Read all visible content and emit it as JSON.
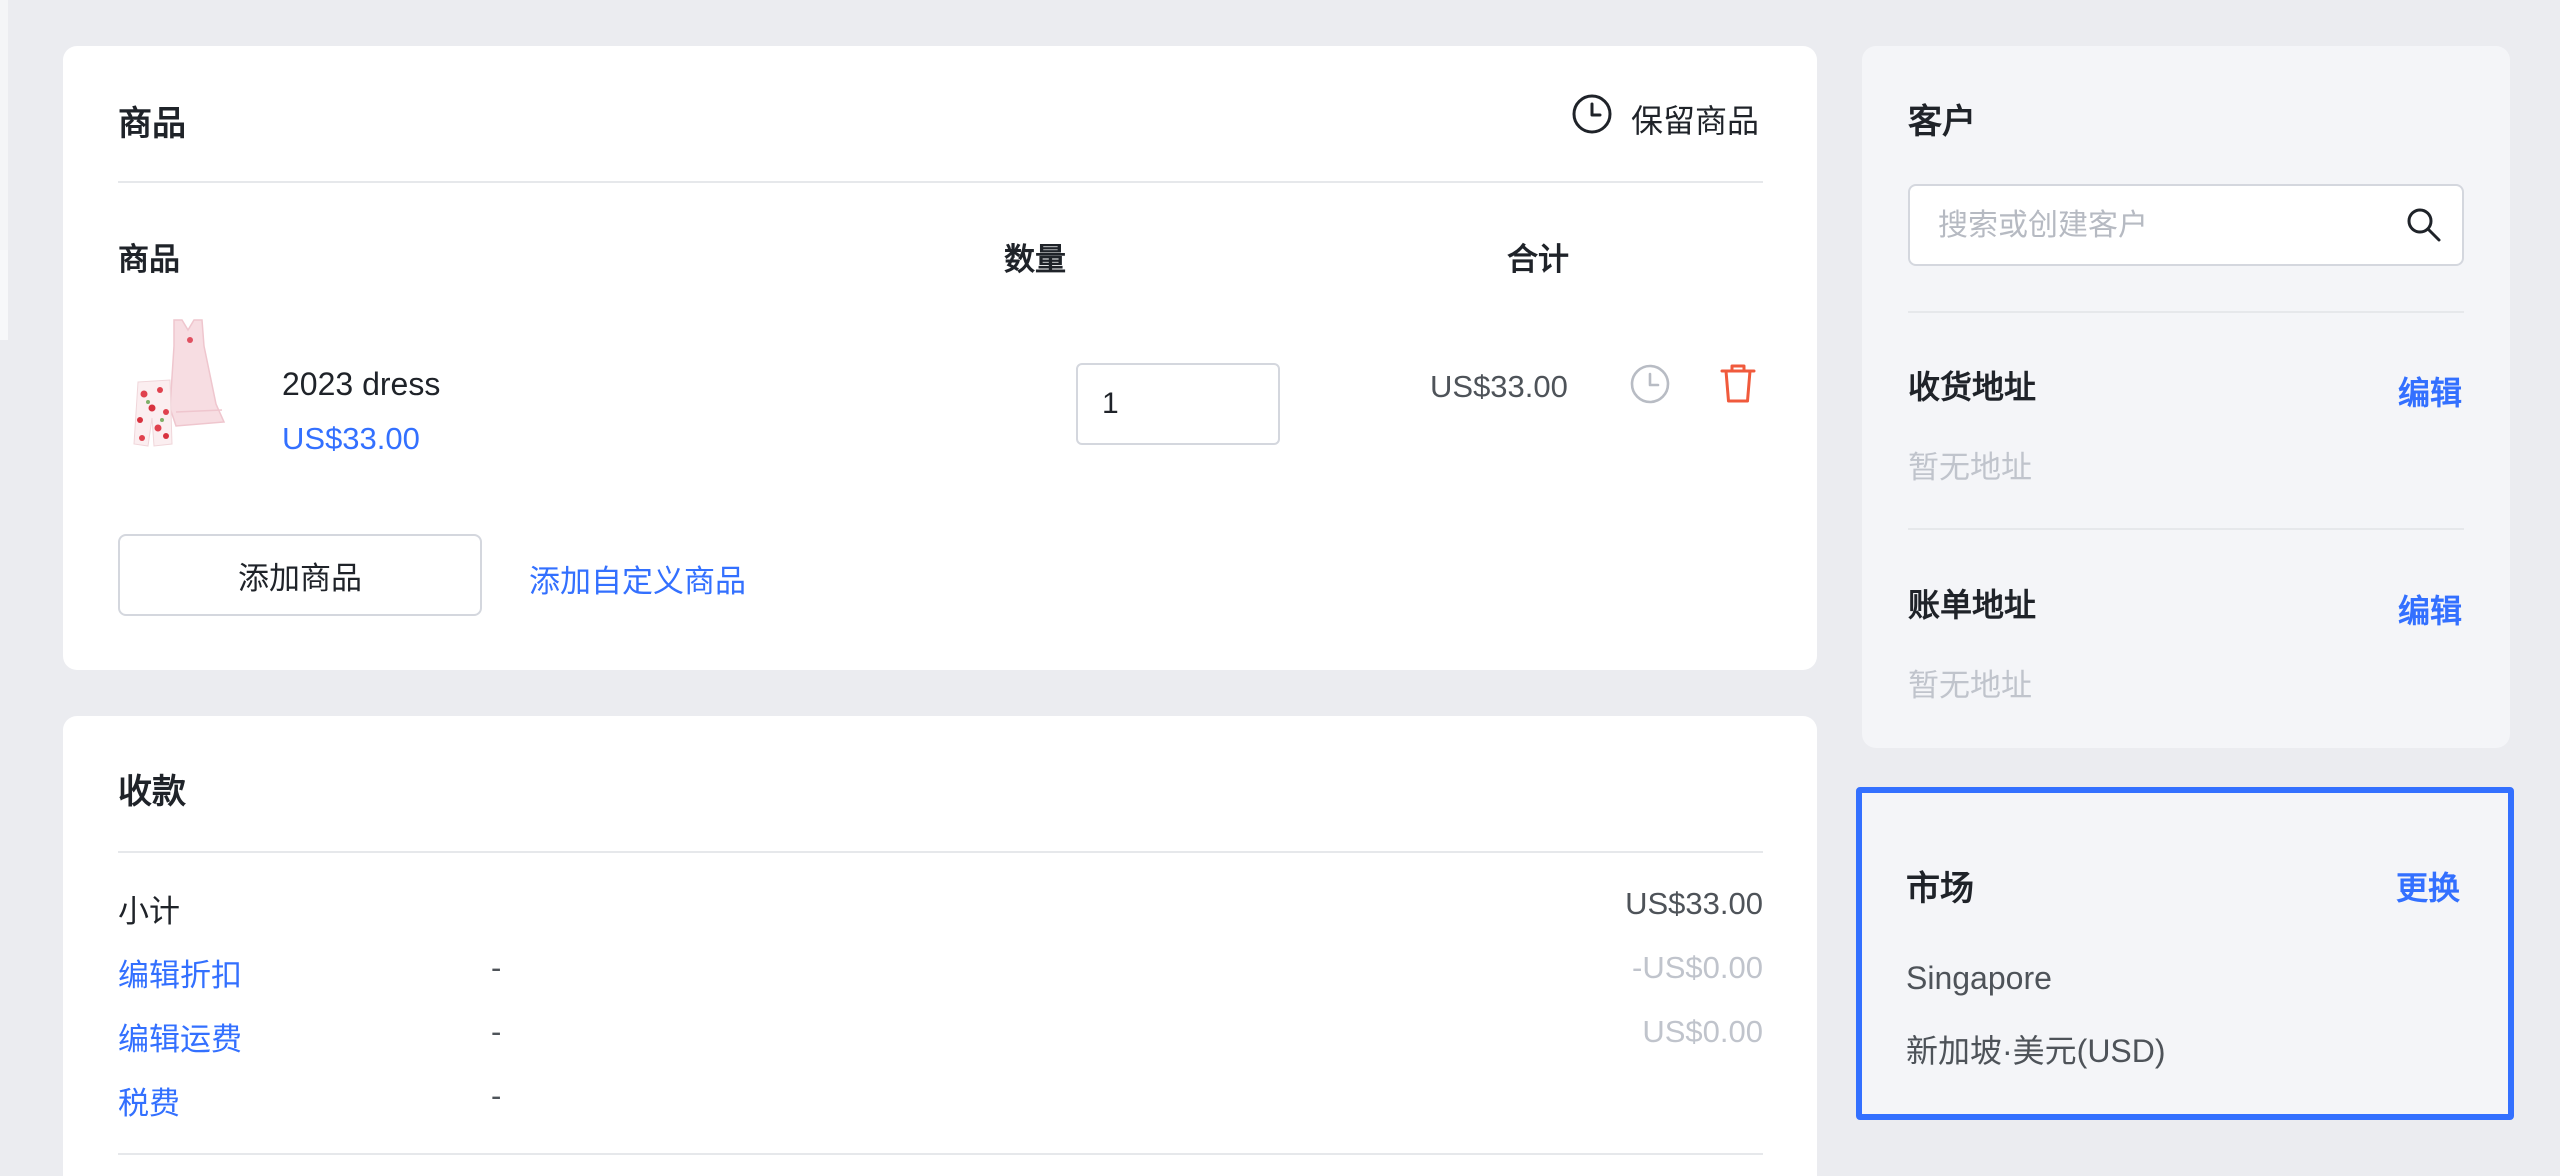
{
  "products_card": {
    "title": "商品",
    "hold_label": "保留商品",
    "columns": {
      "product": "商品",
      "quantity": "数量",
      "total": "合计"
    },
    "items": [
      {
        "name": "2023 dress",
        "price": "US$33.00",
        "quantity": "1",
        "total": "US$33.00"
      }
    ],
    "add_product_label": "添加商品",
    "add_custom_label": "添加自定义商品"
  },
  "payment_card": {
    "title": "收款",
    "rows": [
      {
        "label": "小计",
        "detail": "",
        "value": "US$33.00"
      },
      {
        "label": "编辑折扣",
        "detail": "-",
        "value": "-US$0.00"
      },
      {
        "label": "编辑运费",
        "detail": "-",
        "value": "US$0.00"
      },
      {
        "label": "税费",
        "detail": "-",
        "value": ""
      }
    ]
  },
  "customer_card": {
    "title": "客户",
    "search_placeholder": "搜索或创建客户",
    "shipping": {
      "title": "收货地址",
      "edit_label": "编辑",
      "empty": "暂无地址"
    },
    "billing": {
      "title": "账单地址",
      "edit_label": "编辑",
      "empty": "暂无地址"
    }
  },
  "market_card": {
    "title": "市场",
    "change_label": "更换",
    "market_name": "Singapore",
    "market_detail": "新加坡·美元(USD)"
  },
  "colors": {
    "accent": "#3370ff",
    "delete": "#f05a3c",
    "page_bg": "#ebecf0",
    "card_bg": "#ffffff"
  },
  "icons": {
    "hold": "clock-icon",
    "item_hold": "clock-icon",
    "delete": "trash-icon",
    "search": "search-icon"
  }
}
